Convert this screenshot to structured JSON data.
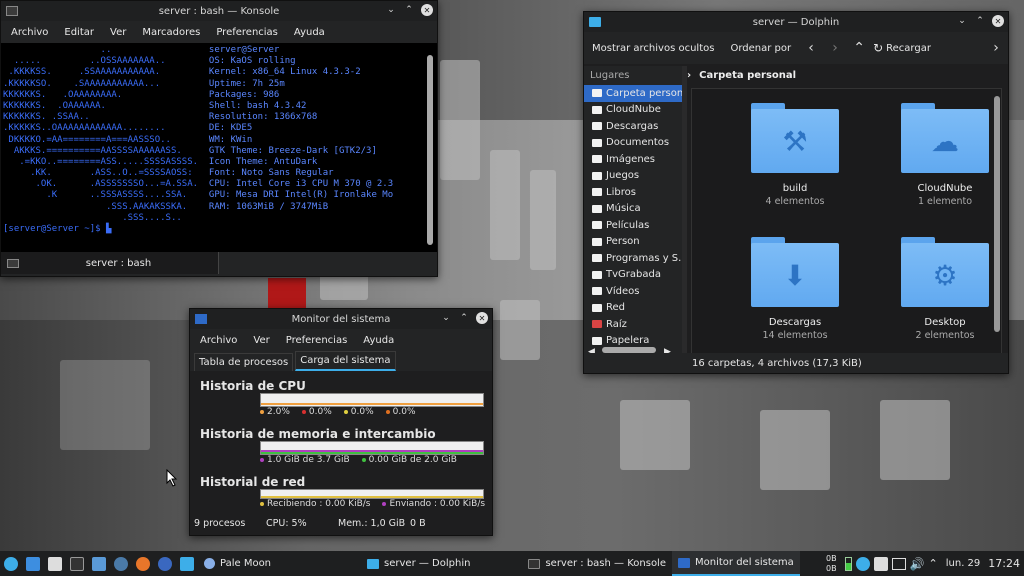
{
  "konsole": {
    "title": "server : bash — Konsole",
    "menu": [
      "Archivo",
      "Editar",
      "Ver",
      "Marcadores",
      "Preferencias",
      "Ayuda"
    ],
    "lines": [
      {
        "art": "                  ..                  ",
        "info": "server@Server"
      },
      {
        "art": "  .....         ..OSSAAAAAAA..        ",
        "info": "OS: KaOS rolling"
      },
      {
        "art": " .KKKKSS.     .SSAAAAAAAAAAA.         ",
        "info": "Kernel: x86_64 Linux 4.3.3-2"
      },
      {
        "art": ".KKKKKSO.    .SAAAAAAAAAAA...         ",
        "info": "Uptime: 7h 25m"
      },
      {
        "art": "KKKKKKS.   .OAAAAAAAA.                ",
        "info": "Packages: 986"
      },
      {
        "art": "KKKKKKS.  .OAAAAAA.                   ",
        "info": "Shell: bash 4.3.42"
      },
      {
        "art": "KKKKKKS. .SSAA..                      ",
        "info": "Resolution: 1366x768"
      },
      {
        "art": ".KKKKKS..OAAAAAAAAAAAA........        ",
        "info": "DE: KDE5"
      },
      {
        "art": " DKKKKO.=AA========A===AASSSO..       ",
        "info": "WM: KWin"
      },
      {
        "art": "  AKKKS.==========AASSSSAAAAAASS.     ",
        "info": "GTK Theme: Breeze-Dark [GTK2/3]"
      },
      {
        "art": "   .=KKO..========ASS.....SSSSASSSS.  ",
        "info": "Icon Theme: AntuDark"
      },
      {
        "art": "     .KK.       .ASS..O..=SSSSAOSS:   ",
        "info": "Font: Noto Sans Regular"
      },
      {
        "art": "      .OK.      .ASSSSSSSO...=A.SSA.  ",
        "info": "CPU: Intel Core i3 CPU M 370 @ 2.3"
      },
      {
        "art": "        .K      ..SSSASSSS....SSA.    ",
        "info": "GPU: Mesa DRI Intel(R) Ironlake Mo"
      },
      {
        "art": "                   .SSS.AAKAKSSKA.    ",
        "info": "RAM: 1063MiB / 3747MiB"
      },
      {
        "art": "                      .SSS....S..     ",
        "info": ""
      }
    ],
    "prompt": "[server@Server ~]$ ▙",
    "tab_label": "server : bash"
  },
  "dolphin": {
    "title": "server — Dolphin",
    "toolbar": {
      "hidden_files": "Mostrar archivos ocultos",
      "sort": "Ordenar por",
      "reload": "Recargar"
    },
    "places_header": "Lugares",
    "places": [
      {
        "label": "Carpeta personal",
        "selected": true
      },
      {
        "label": "CloudNube"
      },
      {
        "label": "Descargas"
      },
      {
        "label": "Documentos"
      },
      {
        "label": "Imágenes"
      },
      {
        "label": "Juegos"
      },
      {
        "label": "Libros"
      },
      {
        "label": "Música"
      },
      {
        "label": "Películas"
      },
      {
        "label": "Person"
      },
      {
        "label": "Programas y S."
      },
      {
        "label": "TvGrabada"
      },
      {
        "label": "Vídeos"
      },
      {
        "label": "Red"
      },
      {
        "label": "Raíz"
      },
      {
        "label": "Papelera"
      }
    ],
    "breadcrumb": "Carpeta personal",
    "items": [
      {
        "name": "build",
        "sub": "4 elementos",
        "icon": "hammer"
      },
      {
        "name": "CloudNube",
        "sub": "1 elemento",
        "icon": "cloud"
      },
      {
        "name": "Descargas",
        "sub": "14 elementos",
        "icon": "download"
      },
      {
        "name": "Desktop",
        "sub": "2 elementos",
        "icon": "kde"
      }
    ],
    "status": "16 carpetas, 4 archivos (17,3 KiB)"
  },
  "sysmon": {
    "title": "Monitor del sistema",
    "menu": [
      "Archivo",
      "Ver",
      "Preferencias",
      "Ayuda"
    ],
    "tabs": [
      "Tabla de procesos",
      "Carga del sistema"
    ],
    "cpu_title": "Historia de CPU",
    "cpu_legend": [
      "2.0%",
      "0.0%",
      "0.0%",
      "0.0%"
    ],
    "mem_title": "Historia de memoria e intercambio",
    "mem_legend": [
      "1.0 GiB de 3.7 GiB",
      "0.00 GiB de 2.0 GiB"
    ],
    "net_title": "Historial de red",
    "net_legend": [
      "Recibiendo : 0.00 KiB/s",
      "Enviando : 0.00 KiB/s"
    ],
    "status": {
      "processes": "9 procesos",
      "cpu": "CPU: 5%",
      "mem": "Mem.: 1,0 GiB",
      "swap": "0 B"
    }
  },
  "taskbar": {
    "palemoon": "Pale Moon",
    "tasks": [
      "server — Dolphin",
      "server : bash — Konsole",
      "Monitor del sistema"
    ],
    "net_up": "0B",
    "net_down": "0B",
    "date": "lun. 29",
    "time": "17:24"
  },
  "colors": {
    "accent": "#3daee9",
    "selection": "#2e6ac7",
    "terminal_text": "#3a6cf7",
    "folder": "#6aaff2"
  }
}
